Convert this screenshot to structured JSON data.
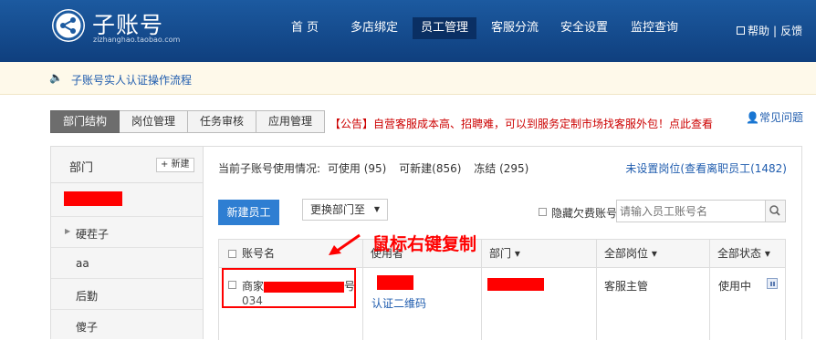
{
  "header": {
    "logo_text": "子账号",
    "logo_sub": "zizhanghao.taobao.com",
    "nav": [
      "首 页",
      "多店绑定",
      "员工管理",
      "客服分流",
      "安全设置",
      "监控查询"
    ],
    "active_nav": "员工管理",
    "help": "帮助",
    "feedback": "反馈"
  },
  "notice": {
    "text": "子账号实人认证操作流程"
  },
  "tabs": [
    "部门结构",
    "岗位管理",
    "任务审核",
    "应用管理"
  ],
  "announcement": "【公告】自营客服成本高、招聘难，可以到服务定制市场找客服外包！点此查看",
  "faq": "常见问题",
  "left_panel": {
    "title": "部门",
    "new_button": "+ 新建",
    "departments": [
      "硬茬子",
      "aa",
      "后勤",
      "傻子"
    ]
  },
  "right_panel": {
    "usage_label": "当前子账号使用情况:",
    "usage_in_use": "可使用 (95)",
    "usage_new": "可新建(856)",
    "usage_frozen": "冻结 (295)",
    "unset_link": "未设置岗位(查看离职员工(1482)",
    "new_employee_button": "新建员工",
    "move_dept_button": "更换部门至",
    "hide_label": "隐藏欠费账号",
    "search_placeholder": "请输入员工账号名",
    "table": {
      "headers": [
        "账号名",
        "使用者",
        "部门 ▾",
        "全部岗位 ▾",
        "全部状态 ▾"
      ],
      "row": {
        "account_prefix": "商家",
        "account_suffix_visible": "号",
        "account_line2": "034",
        "user_link": "认证二维码",
        "position": "客服主管",
        "status": "使用中"
      }
    }
  },
  "annotation": "鼠标右键复制",
  "colors": {
    "header_bg": "#1c5aa0",
    "accent_blue": "#2e7ed2",
    "redaction": "#ff0000"
  }
}
